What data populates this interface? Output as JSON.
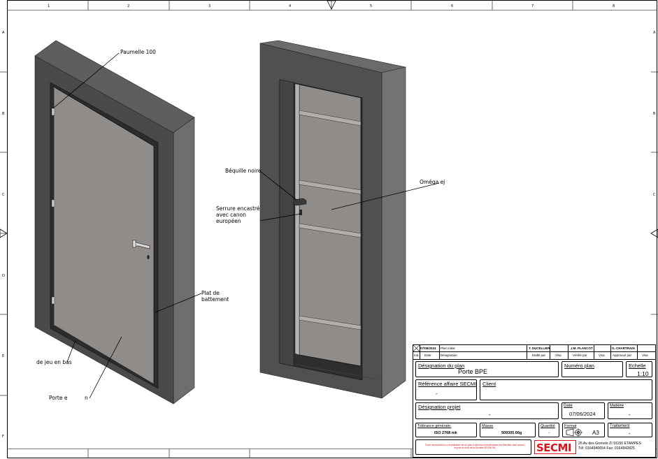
{
  "frame": {
    "columns": [
      "1",
      "2",
      "3",
      "4",
      "5",
      "6",
      "7",
      "8"
    ],
    "rows": [
      "A",
      "B",
      "C",
      "D",
      "E",
      "F"
    ]
  },
  "annotations": {
    "paumelle": "Paumelle 100",
    "bequille": "Béquille noire",
    "serrure_1": "Serrure encastré",
    "serrure_2": "avec canon",
    "serrure_3": "européen",
    "omega": "Oméga ej",
    "plat_1": "Plat de",
    "plat_2": "battement",
    "jeu": "de jeu en bas",
    "porte_a": "Porte e",
    "porte_b": "n"
  },
  "title_block": {
    "revision": {
      "date": "07/06/2024",
      "designation": "Plan initial",
      "etabli_name": "T. DUCELLIER",
      "verifie_name": "J.M. PLANCOT",
      "approuve_name": "G. CHARTRAIN",
      "col_ind": "Ind.",
      "col_date": "Date",
      "col_designation": "Désignation",
      "col_etabli": "Etabli par",
      "col_visa1": "Visa",
      "col_verifie": "Vérifié par",
      "col_visa2": "Visa",
      "col_approuve": "Approuvé par",
      "col_visa3": "Visa"
    },
    "designation_plan_label": "Désignation du plan",
    "designation_plan_value": "Porte BPE",
    "numero_plan_label": "Numéro plan",
    "echelle_label": "Echelle",
    "echelle_value": "1:10",
    "reference_label": "Référence affaire SECMI",
    "reference_value": "-",
    "client_label": "Client",
    "designation_projet_label": "Désignation projet",
    "designation_projet_value": "-",
    "date_label": "Date",
    "date_value": "07/06/2024",
    "matiere_label": "Matière",
    "matiere_value": "-",
    "tolerance_label": "Tolérance générale:",
    "tolerance_value": "ISO 2768 mk",
    "masse_label": "Masse",
    "masse_value": "509305.66g",
    "quantite_label": "Quantité",
    "quantite_value": "-",
    "format_label": "Format",
    "format_value": "A3",
    "traitement_label": "Traitement",
    "traitement_value": "-",
    "copyright": "Toute reproduction ou exploitation de ce plan à des fins commerciales est interdite, sauf accord exprès et écrit de la Société SECMI SA",
    "company": "SECMI",
    "address_1": "26 Av des Grenots ZI 91150 ETAMPES",
    "address_2": "Tél: 0164940654 Fax: 0164942825"
  },
  "colors": {
    "frame_dark": "#4a4a4a",
    "frame_mid": "#606060",
    "frame_light": "#777777",
    "door_panel": "#8f8c8a",
    "door_panel_dark": "#3c3c3c",
    "brand_red": "#d9141b"
  },
  "icons": [
    "projection-icon"
  ]
}
